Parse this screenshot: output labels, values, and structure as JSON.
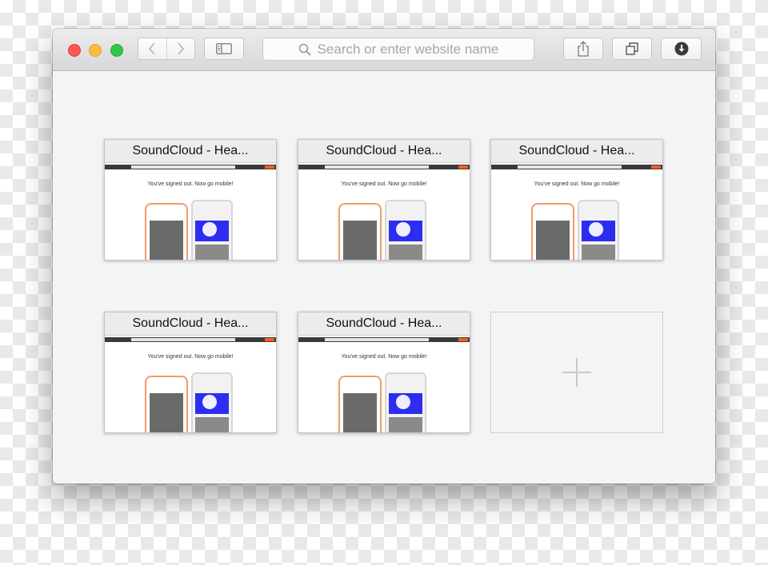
{
  "toolbar": {
    "address_placeholder": "Search or enter website name",
    "icons": {
      "back": "chevron-left-icon",
      "forward": "chevron-right-icon",
      "sidebar": "sidebar-icon",
      "search": "search-icon",
      "share": "share-icon",
      "tabs": "tabs-icon",
      "download": "download-icon"
    }
  },
  "traffic_lights": {
    "close": "#fc5753",
    "minimize": "#fdbc40",
    "zoom": "#33c748"
  },
  "top_sites": [
    {
      "title": "SoundCloud - Hea...",
      "tagline": "You've signed out. Now go mobile!"
    },
    {
      "title": "SoundCloud - Hea...",
      "tagline": "You've signed out. Now go mobile!"
    },
    {
      "title": "SoundCloud - Hea...",
      "tagline": "You've signed out. Now go mobile!"
    },
    {
      "title": "SoundCloud - Hea...",
      "tagline": "You've signed out. Now go mobile!"
    },
    {
      "title": "SoundCloud - Hea...",
      "tagline": "You've signed out. Now go mobile!"
    }
  ],
  "add_tile": {
    "icon": "plus-icon"
  },
  "accent_colors": {
    "soundcloud_orange": "#f65e1b"
  }
}
